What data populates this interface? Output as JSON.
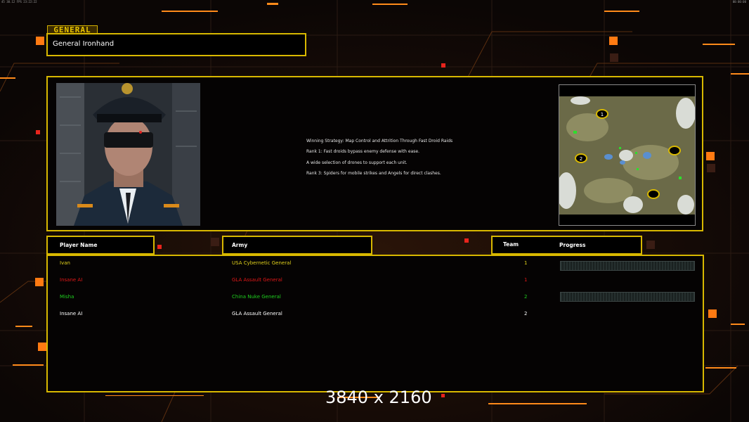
{
  "topbar": {
    "left_text": "45  30.12  FPS  23:22:22",
    "right_text": "00:00:00"
  },
  "general": {
    "tab_label": "GENERAL",
    "name": "General Ironhand"
  },
  "strategy": {
    "lines": [
      "Winning Strategy: Map Control and Attrition Through Fast Droid Raids",
      "Rank 1: Fast droids bypass enemy defense with ease.",
      "A wide selection of drones to support each unit.",
      "Rank 3: Spiders for mobile strikes and Angels for direct clashes."
    ]
  },
  "minimap": {
    "markers": [
      "1",
      "2"
    ]
  },
  "headers": {
    "player_name": "Player Name",
    "army": "Army",
    "team": "Team",
    "progress": "Progress"
  },
  "players": [
    {
      "name": "Ivan",
      "army": "USA Cybernetic General",
      "team": "1",
      "color": "#e2d21c",
      "name_color": "#e2d21c",
      "progress": true
    },
    {
      "name": "Insane AI",
      "army": "GLA Assault General",
      "team": "1",
      "color": "#e01818",
      "name_color": "#e01818",
      "progress": false
    },
    {
      "name": "Misha",
      "army": "China Nuke General",
      "team": "2",
      "color": "#1fd01f",
      "name_color": "#1fd01f",
      "progress": true
    },
    {
      "name": "Insane AI",
      "army": "GLA Assault General",
      "team": "2",
      "color": "#ffffff",
      "name_color": "#ffffff",
      "progress": false
    }
  ],
  "watermark": "3840 x 2160",
  "colors": {
    "frame": "#d8b800",
    "accent_orange": "#ff8a1a",
    "background": "#0b0605"
  }
}
